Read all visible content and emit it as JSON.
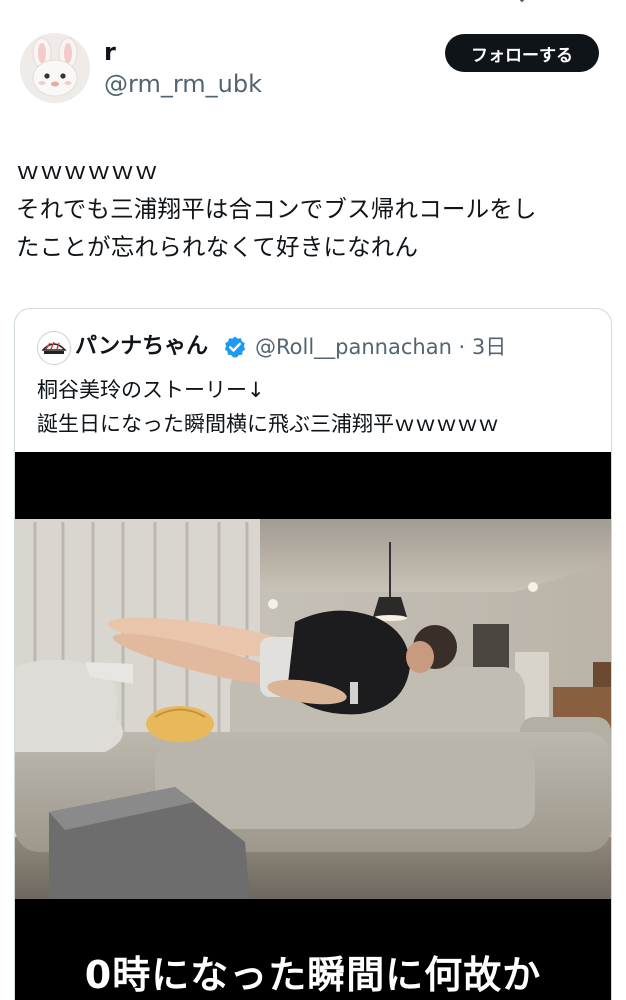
{
  "author": {
    "name": "r",
    "handle": "@rm_rm_ubk",
    "follow_label": "フォローする"
  },
  "tweet": {
    "lines": [
      "ｗｗｗｗｗｗ",
      "それでも三浦翔平は合コンでブス帰れコールをし",
      "たことが忘れられなくて好きになれん"
    ]
  },
  "quoted": {
    "name": "パンナちゃん",
    "handle_time": "@Roll__pannachan · 3日",
    "lines": [
      "桐谷美玲のストーリー↓",
      "誕生日になった瞬間横に飛ぶ三浦翔平ｗｗｗｗｗ"
    ],
    "media_caption": "0時になった瞬間に何故か"
  },
  "colors": {
    "text": "#0f1419",
    "secondary": "#536471",
    "verified": "#1d9bf0",
    "button_bg": "#0f1419"
  }
}
